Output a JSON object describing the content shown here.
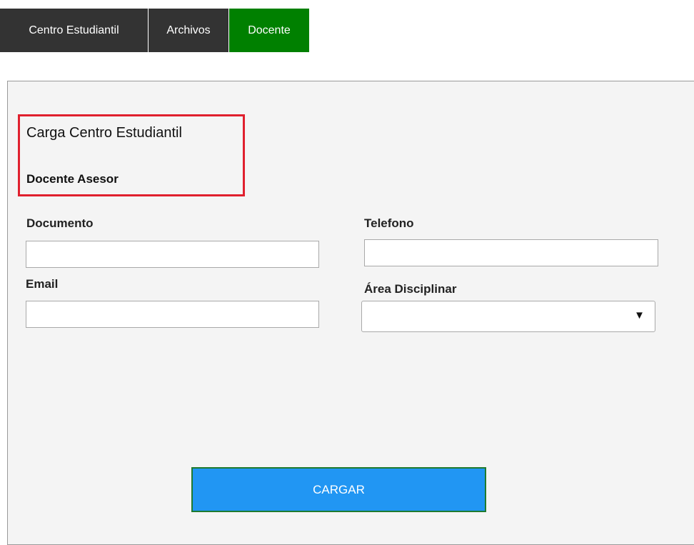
{
  "colors": {
    "tab_bg": "#333333",
    "tab_active_bg": "#008000",
    "button_bg": "#2196f3"
  },
  "tabs": [
    {
      "label": "Centro Estudiantil",
      "active": false
    },
    {
      "label": "Archivos",
      "active": false
    },
    {
      "label": "Docente",
      "active": true
    }
  ],
  "form": {
    "title": "Carga Centro Estudiantil",
    "subtitle": "Docente Asesor",
    "fields": {
      "documento": {
        "label": "Documento",
        "value": "",
        "placeholder": ""
      },
      "telefono": {
        "label": "Telefono",
        "value": "",
        "placeholder": ""
      },
      "email": {
        "label": "Email",
        "value": "",
        "placeholder": ""
      },
      "area": {
        "label": "Área Disciplinar",
        "value": ""
      }
    },
    "submit_label": "CARGAR"
  }
}
